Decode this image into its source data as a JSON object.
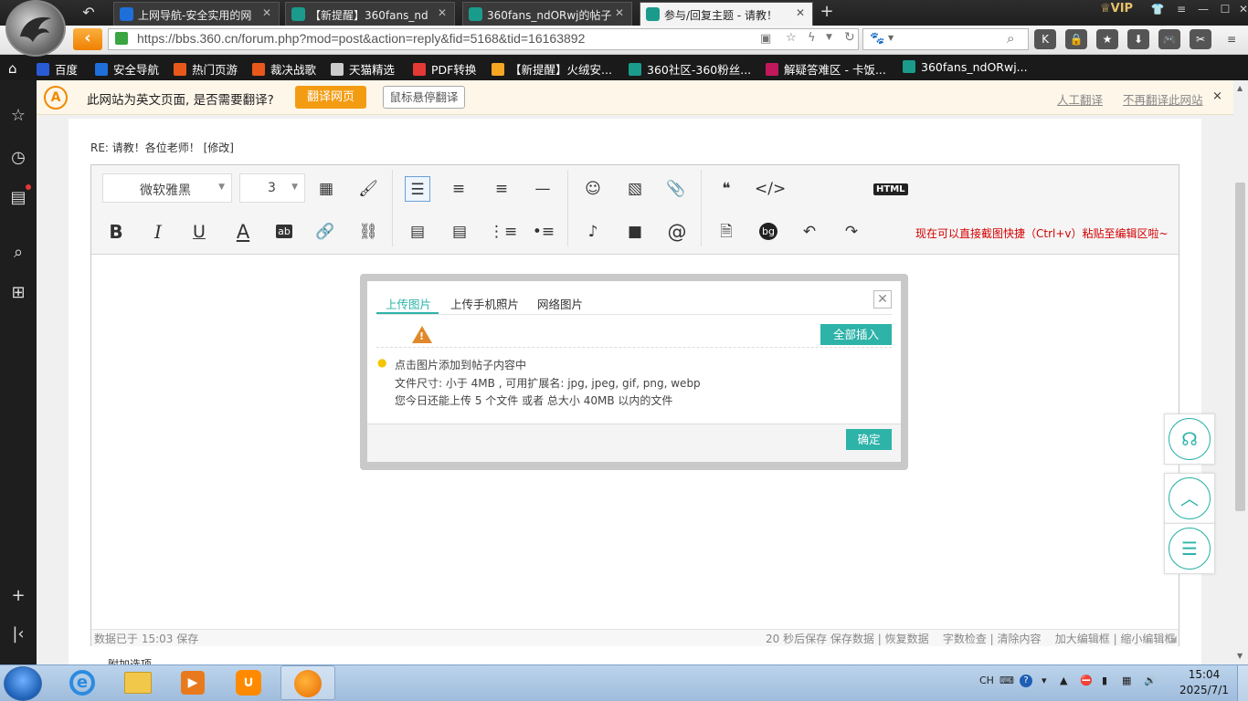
{
  "browser": {
    "tabs": [
      {
        "title": "上网导航-安全实用的网",
        "icon_color": "#1e6fd9"
      },
      {
        "title": "【新提醒】360fans_nd",
        "icon_color": "#1a9b8c"
      },
      {
        "title": "360fans_ndORwj的帖子",
        "icon_color": "#1a9b8c"
      },
      {
        "title": "参与/回复主题 - 请教！",
        "icon_color": "#1a9b8c"
      }
    ],
    "new_tab": "+",
    "vip": "VIP",
    "url": "https://bbs.360.cn/forum.php?mod=post&action=reply&fid=5168&tid=16163892",
    "bookmarks": [
      {
        "label": "百度",
        "color": "#2a5bd7"
      },
      {
        "label": "安全导航",
        "color": "#1e6fd9"
      },
      {
        "label": "热门页游",
        "color": "#e8581a"
      },
      {
        "label": "裁决战歌",
        "color": "#e8581a"
      },
      {
        "label": "天猫精选",
        "color": "#cccccc"
      },
      {
        "label": "PDF转换",
        "color": "#e53935"
      },
      {
        "label": "【新提醒】火绒安...",
        "color": "#f5a623"
      },
      {
        "label": "360社区-360粉丝...",
        "color": "#1a9b8c"
      },
      {
        "label": "解疑答难区 - 卡饭...",
        "color": "#c2185b"
      },
      {
        "label": "360fans_ndORwj...",
        "color": "#1a9b8c"
      }
    ]
  },
  "translate_bar": {
    "question": "此网站为英文页面, 是否需要翻译?",
    "translate_btn": "翻译网页",
    "hover_btn": "鼠标悬停翻译",
    "manual": "人工翻译",
    "never": "不再翻译此网站",
    "close": "×"
  },
  "post": {
    "title": "RE: 请教！各位老师！ [修改]"
  },
  "editor": {
    "font": "微软雅黑",
    "size": "3",
    "html_label": "HTML",
    "paste_hint": "现在可以直接截图快捷（Ctrl+v）粘贴至编辑区啦~",
    "status_left": "数据已于 15:03 保存",
    "status_right": "20 秒后保存 保存数据 | 恢复数据    字数检查 | 清除内容    加大编辑框 | 缩小编辑框"
  },
  "dialog": {
    "tabs": [
      "上传图片",
      "上传手机照片",
      "网络图片"
    ],
    "insert_all": "全部插入",
    "tip": "点击图片添加到帖子内容中",
    "line2": "文件尺寸: 小于 4MB , 可用扩展名: jpg, jpeg, gif, png, webp",
    "line3": "您今日还能上传 5 个文件 或者 总大小 40MB 以内的文件",
    "ok": "确定"
  },
  "below_editor": "附加选项",
  "taskbar": {
    "lang": "CH",
    "time": "15:04",
    "date": "2025/7/1"
  },
  "colors": {
    "accent": "#2eb3a9",
    "orange": "#f39c12",
    "hint_red": "#d40000"
  }
}
